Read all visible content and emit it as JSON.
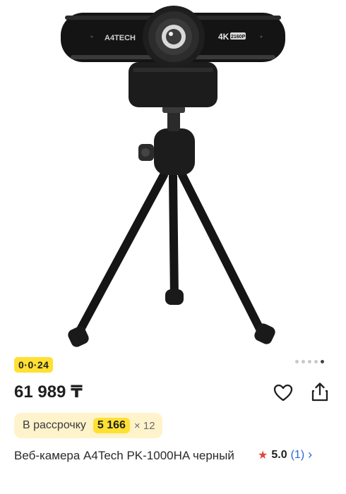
{
  "product": {
    "promo_badge": "0·0·24",
    "price": "61 989 ₸",
    "installment": {
      "label": "В рассрочку",
      "amount": "5 166",
      "multiplier": "× 12"
    },
    "title": "Веб-камера A4Tech PK-1000HA черный",
    "rating": {
      "score": "5.0",
      "count": "(1)"
    },
    "camera_brand": "A4TECH",
    "camera_badge_4k": "4K",
    "camera_badge_res": "2160P",
    "gallery": {
      "total": 5,
      "active": 5
    }
  },
  "icons": {
    "favorite": "heart-icon",
    "share": "share-icon",
    "rating": "star-icon",
    "more": "chevron-right-icon"
  },
  "colors": {
    "promo_yellow": "#ffe033",
    "installment_bg": "#fff3cc",
    "star_red": "#e0453a",
    "link_blue": "#2a66d9"
  }
}
